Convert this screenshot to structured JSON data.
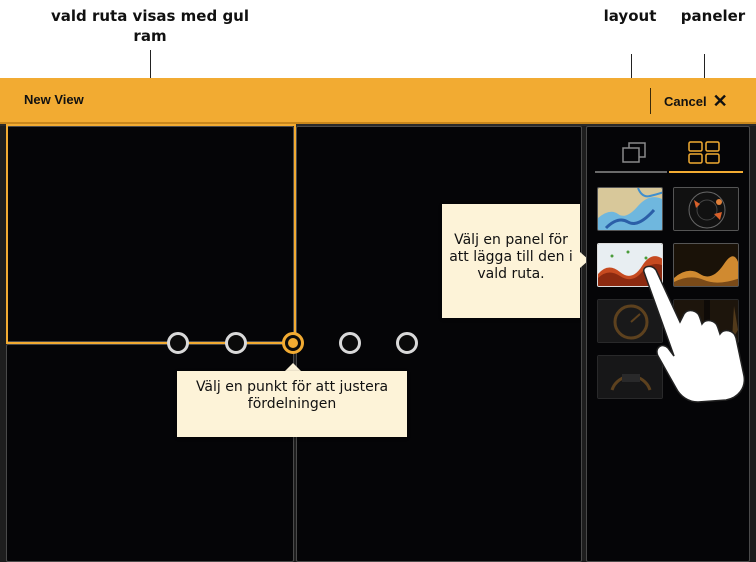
{
  "callouts": {
    "selected_pane": "vald ruta visas med gul ram",
    "layout": "layout",
    "panels": "paneler"
  },
  "titlebar": {
    "title": "New View",
    "cancel_label": "Cancel",
    "cancel_icon": "close-icon"
  },
  "split_points": {
    "count": 5,
    "active_index": 2
  },
  "tooltips": {
    "split": "Välj en punkt för att justera fördelningen",
    "panel": "Välj en panel för att lägga till den i vald ruta."
  },
  "sidepanel": {
    "tabs": [
      {
        "name": "layout",
        "icon": "layout-icon",
        "active": false
      },
      {
        "name": "panels",
        "icon": "panels-grid-icon",
        "active": true
      }
    ],
    "thumbnails": [
      {
        "name": "chart-thumb",
        "icon": "chart-map"
      },
      {
        "name": "radar-thumb",
        "icon": "radar"
      },
      {
        "name": "sonar-2d-thumb",
        "icon": "sonar-2d"
      },
      {
        "name": "downscan-thumb",
        "icon": "downscan"
      },
      {
        "name": "gauge-thumb",
        "icon": "gauge"
      },
      {
        "name": "sidescan-thumb",
        "icon": "sidescan"
      },
      {
        "name": "instrument-thumb",
        "icon": "instrument-gauge"
      }
    ]
  },
  "colors": {
    "accent": "#f2ab32",
    "pane_background": "#050507",
    "tooltip_background": "#fdf3d8"
  }
}
